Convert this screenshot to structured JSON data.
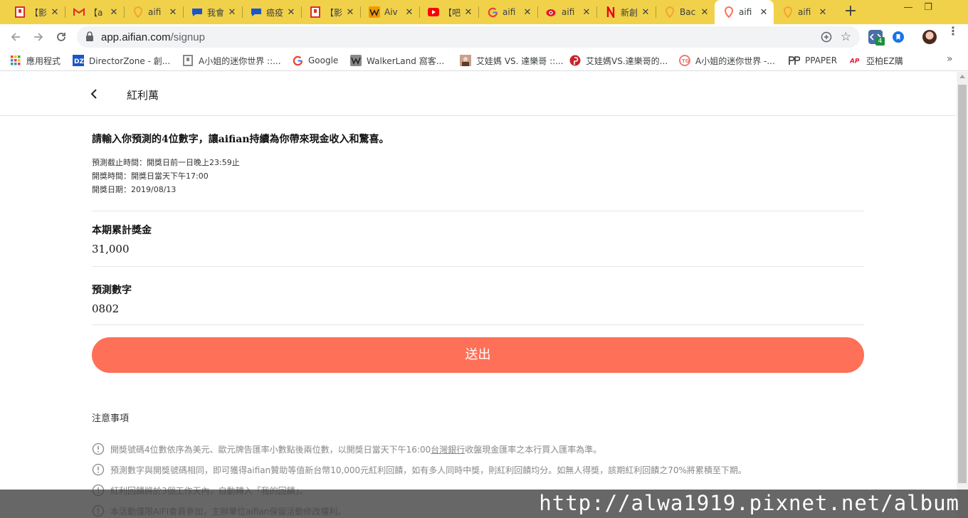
{
  "browser": {
    "tabs": [
      {
        "title": "【影",
        "icon": "bookmark-red-icon",
        "color": "#d93025"
      },
      {
        "title": "【a",
        "icon": "gmail-icon",
        "color": "#d93025"
      },
      {
        "title": "aifi",
        "icon": "aifian-pin-icon",
        "color": "#f4a338"
      },
      {
        "title": "我會",
        "icon": "chat-blue-icon",
        "color": "#1a56c9"
      },
      {
        "title": "癌疫",
        "icon": "chat-blue-icon",
        "color": "#1a56c9"
      },
      {
        "title": "【影",
        "icon": "bookmark-red-icon",
        "color": "#d93025"
      },
      {
        "title": "Aiv",
        "icon": "walkerland-w-icon",
        "color": "#f29900"
      },
      {
        "title": "【吧",
        "icon": "youtube-icon",
        "color": "#ff0000"
      },
      {
        "title": "aifi",
        "icon": "google-g-icon",
        "color": "#4285f4"
      },
      {
        "title": "aifi",
        "icon": "weibo-eye-icon",
        "color": "#e6162d"
      },
      {
        "title": "新創",
        "icon": "netflix-n-icon",
        "color": "#e50914"
      },
      {
        "title": "Bac",
        "icon": "aifian-pin-icon",
        "color": "#f4a338"
      },
      {
        "title": "aifi",
        "icon": "aifian-pin-icon",
        "color": "#fe7057",
        "active": true
      },
      {
        "title": "aifi",
        "icon": "aifian-pin-icon",
        "color": "#f4a338"
      }
    ],
    "close_glyph": "✕",
    "new_tab_glyph": "+",
    "window_controls": {
      "minimize": "—",
      "restore": "❐"
    },
    "address": {
      "host": "app.aifian.com",
      "path": "/signup"
    },
    "extension_badge": "4",
    "bookmarks": [
      {
        "label": "應用程式",
        "icon": "apps-grid-icon"
      },
      {
        "label": "DirectorZone - 創...",
        "icon": "directorzone-icon"
      },
      {
        "label": "A小姐的迷你世界 ::...",
        "icon": "bookmark-red-icon"
      },
      {
        "label": "Google",
        "icon": "google-g-icon"
      },
      {
        "label": "WalkerLand 窩客...",
        "icon": "walkerland-w-icon"
      },
      {
        "label": "艾娃媽 VS. 達樂哥 ::...",
        "icon": "avatar-photo-icon"
      },
      {
        "label": "艾娃媽VS.達樂哥的...",
        "icon": "pinterest-icon"
      },
      {
        "label": "A小姐的迷你世界 -...",
        "icon": "blog-circle-icon"
      },
      {
        "label": "PPAPER",
        "icon": "ppaper-icon"
      },
      {
        "label": "亞柏EZ購",
        "icon": "ap-logo-icon"
      }
    ],
    "bookmarks_overflow": "»"
  },
  "page": {
    "header_title": "紅利萬",
    "intro": "請輸入你預測的4位數字，讓aifian持續為你帶來現金收入和驚喜。",
    "info_lines": [
      "預測截止時間：開獎日前一日晚上23:59止",
      "開獎時間：開獎日當天下午17:00",
      "開獎日期：2019/08/13"
    ],
    "prize_label": "本期累計獎金",
    "prize_value": "31,000",
    "prediction_label": "預測數字",
    "prediction_value": "0802",
    "submit_label": "送出",
    "notes_title": "注意事項",
    "notes": [
      {
        "before": "開獎號碼4位數依序為美元、歐元牌告匯率小數點後兩位數，以開獎日當天下午16:00",
        "link": "台灣銀行",
        "after": "收盤現金匯率之本行買入匯率為準。"
      },
      {
        "before": "預測數字與開獎號碼相同，即可獲得aifian贊助等值新台幣10,000元紅利回饋，如有多人同時中獎，則紅利回饋均分。如無人得獎，該期紅利回饋之70%將累積至下期。",
        "link": "",
        "after": ""
      },
      {
        "before": "紅利回饋將於3個工作天內，自動轉入「我的回饋」。",
        "link": "",
        "after": ""
      },
      {
        "before": "本活動僅限AIFI會員參加，主辦單位aifian保留活動修改權利。",
        "link": "",
        "after": ""
      }
    ]
  },
  "colors": {
    "accent": "#fe7057",
    "tabstrip": "#f1d149"
  },
  "watermark": "http://alwa1919.pixnet.net/album"
}
